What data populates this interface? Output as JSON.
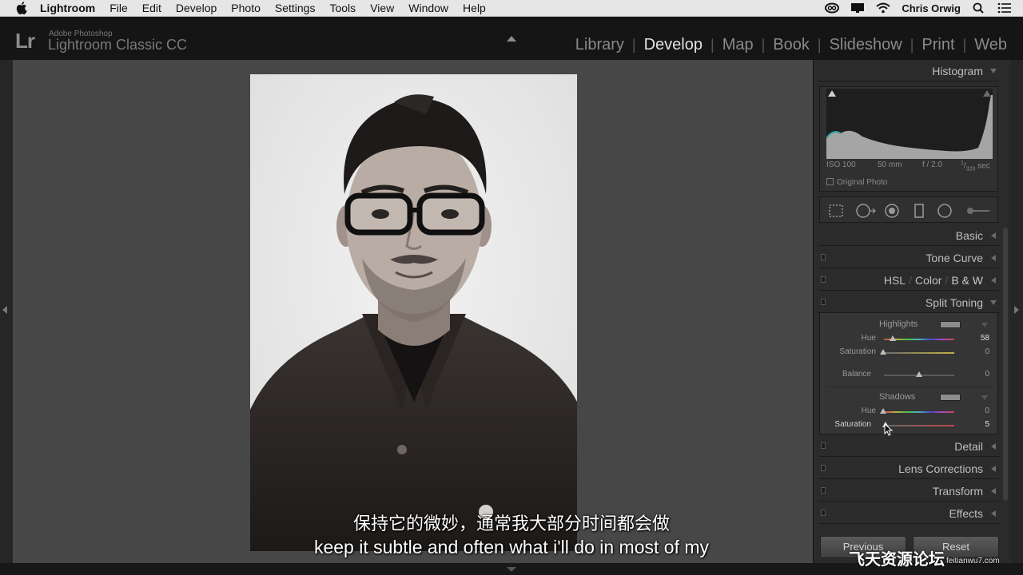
{
  "menubar": {
    "app_name": "Lightroom",
    "menus": [
      "File",
      "Edit",
      "Develop",
      "Photo",
      "Settings",
      "Tools",
      "View",
      "Window",
      "Help"
    ],
    "user": "Chris Orwig"
  },
  "identity": {
    "logo": "Lr",
    "vendor": "Adobe Photoshop",
    "product": "Lightroom Classic CC"
  },
  "modules": [
    "Library",
    "Develop",
    "Map",
    "Book",
    "Slideshow",
    "Print",
    "Web"
  ],
  "active_module": "Develop",
  "histogram": {
    "title": "Histogram",
    "iso": "ISO 100",
    "focal": "50 mm",
    "aperture": "f / 2.0",
    "shutter_num": "1",
    "shutter_den": "320",
    "shutter_unit": "sec",
    "original_photo": "Original Photo"
  },
  "panels": {
    "basic": "Basic",
    "tone_curve": "Tone Curve",
    "hsl": "HSL",
    "color": "Color",
    "bw": "B & W",
    "split_toning": "Split Toning",
    "detail": "Detail",
    "lens_corrections": "Lens Corrections",
    "transform": "Transform",
    "effects": "Effects"
  },
  "split_toning": {
    "highlights_title": "Highlights",
    "shadows_title": "Shadows",
    "hue_label": "Hue",
    "saturation_label": "Saturation",
    "balance_label": "Balance",
    "highlights_hue": "58",
    "highlights_saturation": "0",
    "balance": "0",
    "shadows_hue": "0",
    "shadows_saturation": "5"
  },
  "buttons": {
    "previous": "Previous",
    "reset": "Reset"
  },
  "subtitles": {
    "zh": "保持它的微妙，通常我大部分时间都会做",
    "en": "keep it subtle and often what i'll do in most of my"
  },
  "watermark": {
    "text": "飞天资源论坛",
    "site": "feitianwu7.com"
  },
  "colors": {
    "accent_text": "#e2e2e2",
    "panel_bg": "#2b2b2b",
    "canvas_bg": "#474747"
  }
}
